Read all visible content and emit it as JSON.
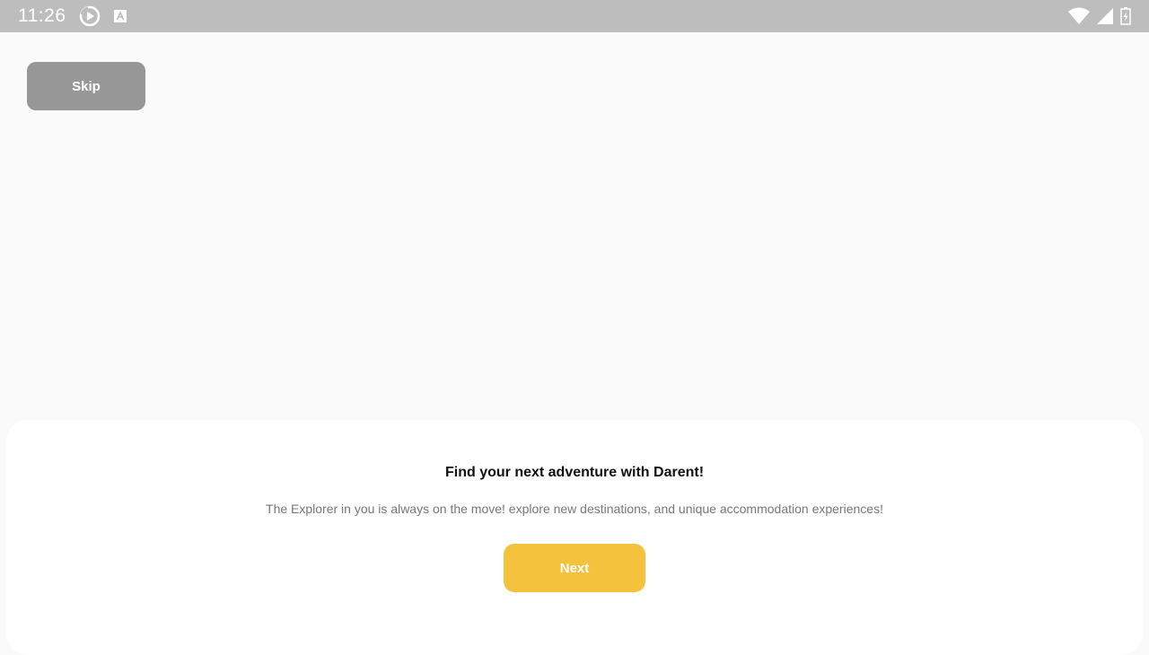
{
  "status_bar": {
    "time": "11:26",
    "left_icons": [
      "media-player-icon",
      "text-a-icon"
    ],
    "right_icons": [
      "wifi-icon",
      "cellular-signal-icon",
      "battery-charging-icon"
    ]
  },
  "onboarding": {
    "skip_label": "Skip",
    "title": "Find your next adventure with Darent!",
    "description": "The Explorer in you is always on the move! explore new destinations, and unique accommodation experiences!",
    "next_label": "Next"
  },
  "colors": {
    "status_bar_bg": "#bdbdbd",
    "page_bg": "#fafafa",
    "skip_button_bg": "#979797",
    "next_button_bg": "#f4c23c",
    "card_bg": "#ffffff"
  }
}
